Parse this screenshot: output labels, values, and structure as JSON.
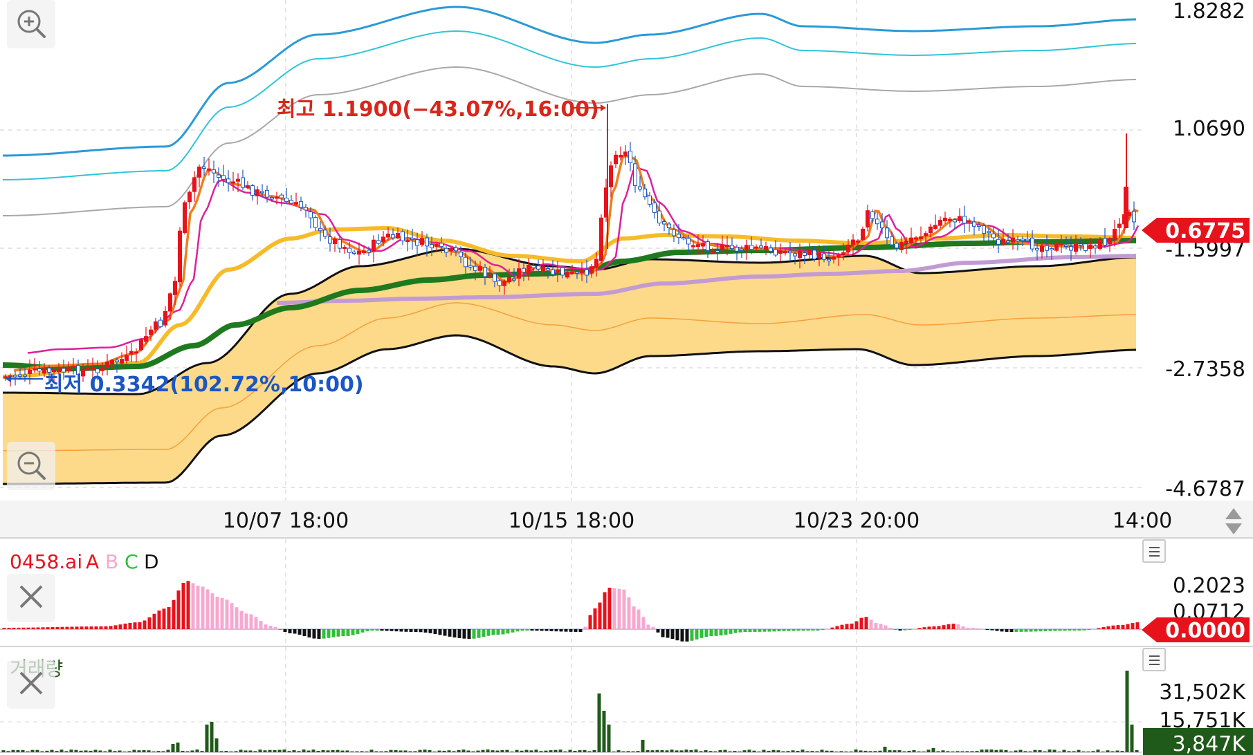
{
  "price_axis_ticks": [
    "1.8282",
    "1.0690",
    "-1.5997",
    "-2.7358",
    "-4.6787"
  ],
  "last_price": "0.6775",
  "time_labels": [
    "10/07 18:00",
    "10/15 18:00",
    "10/23 20:00",
    "14:00"
  ],
  "annotations": {
    "high": "최고 1.1900(−43.07%,16:00)",
    "low": "최저 0.3342(102.72%,10:00)"
  },
  "indicator": {
    "name": "0458.ai",
    "legend": [
      {
        "label": "A",
        "color": "#e8121c"
      },
      {
        "label": "B",
        "color": "#f7a8cf"
      },
      {
        "label": "C",
        "color": "#2fbf3a"
      },
      {
        "label": "D",
        "color": "#111111"
      }
    ],
    "ticks": [
      "0.2023",
      "0.0712"
    ],
    "current": "0.0000"
  },
  "volume": {
    "title": "거래량",
    "ticks": [
      "31,502K",
      "15,751K"
    ],
    "current": "3,847K"
  },
  "colors": {
    "up": "#e8121c",
    "down": "#1a56c4",
    "cloud": "#fdd98a",
    "ma_orange": "#f07d1e",
    "ma_magenta": "#e01e9a",
    "ma_yellow": "#f7bb2a",
    "ma_green": "#1f7a1f",
    "ma_lavender": "#c39bd3",
    "band_blue": "#2a9ad6",
    "band_cyan": "#2fc5d8",
    "band_gray": "#a8a8a8",
    "volume_bar": "#1f5a1a",
    "price_badge": "#e8121c",
    "volume_badge": "#1f5a1a"
  },
  "icons": {
    "zoom_in": "zoom-in-icon",
    "zoom_out": "zoom-out-icon",
    "close": "close-icon",
    "menu": "menu-icon",
    "scroll": "up-down-arrows-icon"
  },
  "chart_data": {
    "type": "candlestick",
    "x_labels": [
      "10/07 18:00",
      "10/15 18:00",
      "10/23 20:00",
      "14:00"
    ],
    "y_ticks": [
      1.8282,
      1.069,
      -1.5997,
      -2.7358,
      -4.6787
    ],
    "last_price": 0.6775,
    "high": {
      "value": 1.19,
      "change_pct": -43.07,
      "time": "16:00"
    },
    "low": {
      "value": 0.3342,
      "change_pct": 102.72,
      "time": "10:00"
    },
    "indicator_series": [
      "A",
      "B",
      "C",
      "D"
    ],
    "indicator_ticks": [
      0.2023,
      0.0712
    ],
    "indicator_current": 0.0,
    "volume_ticks": [
      "31,502K",
      "15,751K"
    ],
    "volume_current": "3,847K"
  }
}
